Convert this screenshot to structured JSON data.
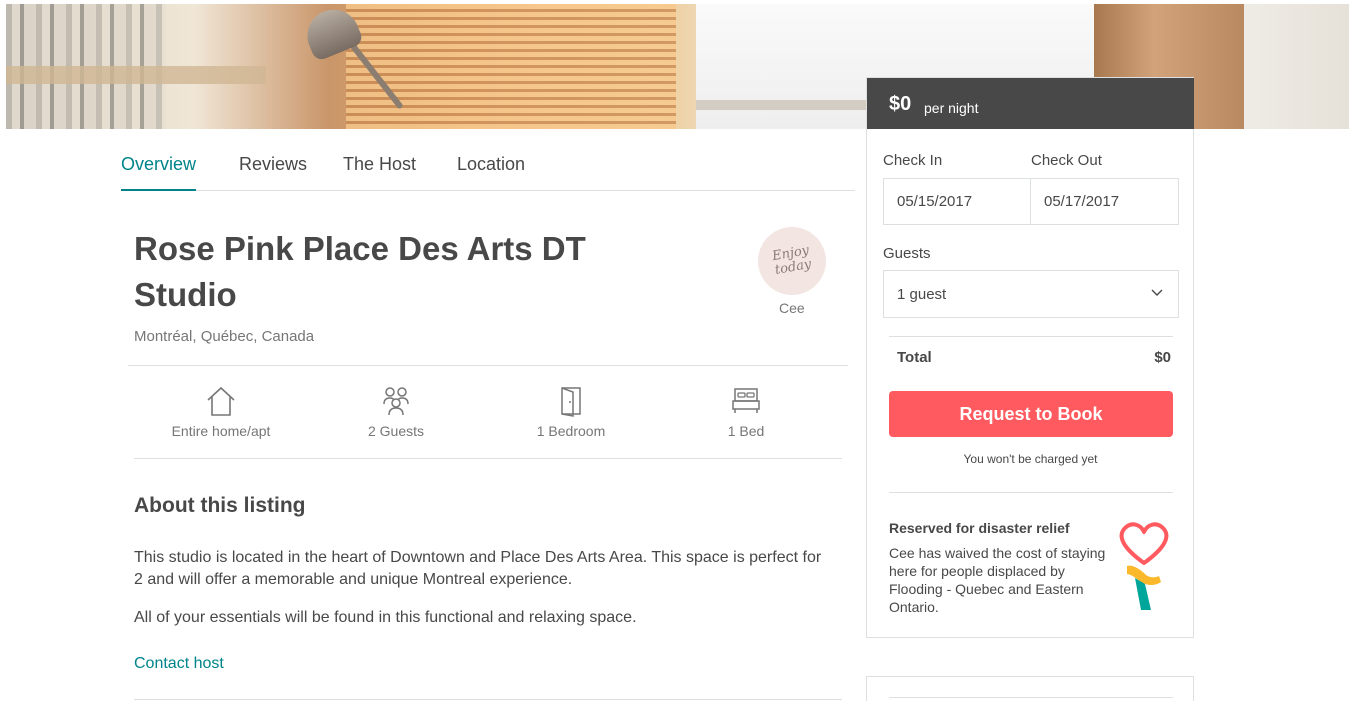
{
  "tabs": [
    {
      "label": "Overview",
      "active": true
    },
    {
      "label": "Reviews"
    },
    {
      "label": "The Host"
    },
    {
      "label": "Location"
    }
  ],
  "listing": {
    "title": "Rose Pink Place Des Arts DT Studio",
    "location": "Montréal, Québec, Canada"
  },
  "host": {
    "name": "Cee",
    "avatar_script": "Enjoy today"
  },
  "amenities": [
    {
      "icon": "home-icon",
      "label": "Entire home/apt"
    },
    {
      "icon": "guests-icon",
      "label": "2 Guests"
    },
    {
      "icon": "door-icon",
      "label": "1 Bedroom"
    },
    {
      "icon": "bed-icon",
      "label": "1 Bed"
    }
  ],
  "about": {
    "heading": "About this listing",
    "paragraphs": [
      "This studio is located in the heart of Downtown and Place Des Arts Area. This space is perfect for 2 and will offer a memorable and unique Montreal experience.",
      "All of your essentials will be found in this functional and relaxing space."
    ],
    "contact_label": "Contact host"
  },
  "booking": {
    "price": "$0",
    "per_night": "per night",
    "check_in_label": "Check In",
    "check_out_label": "Check Out",
    "check_in": "05/15/2017",
    "check_out": "05/17/2017",
    "guests_label": "Guests",
    "guests_value": "1 guest",
    "total_label": "Total",
    "total_value": "$0",
    "button_label": "Request to Book",
    "note": "You won't be charged yet",
    "accent_color": "#ff5a5f"
  },
  "relief": {
    "heading": "Reserved for disaster relief",
    "text": "Cee has waived the cost of staying here for people displaced by Flooding - Quebec and Eastern Ontario.",
    "icon": "heart-hand-icon"
  },
  "colors": {
    "teal": "#008489",
    "text": "#484848",
    "muted": "#767676",
    "header_dark": "#484848"
  }
}
